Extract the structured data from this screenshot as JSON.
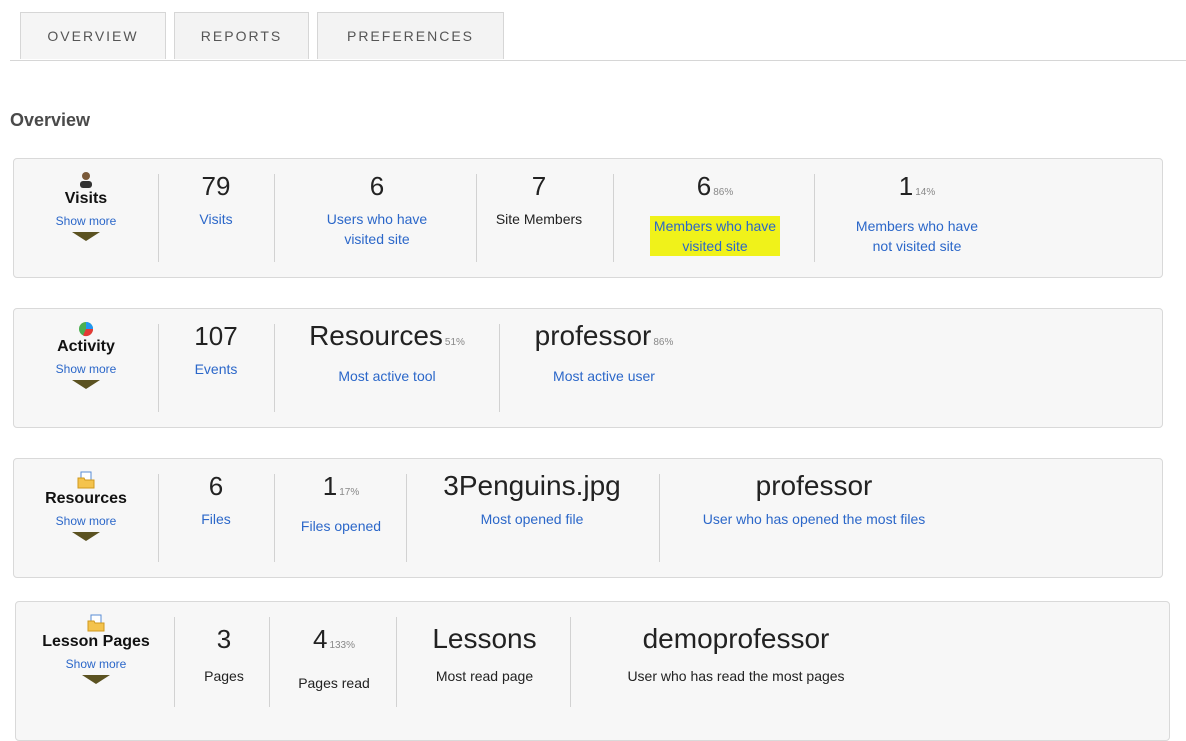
{
  "tabs": [
    "OVERVIEW",
    "REPORTS",
    "PREFERENCES"
  ],
  "page_title": "Overview",
  "visits": {
    "title": "Visits",
    "show_more": "Show more",
    "total_visits": "79",
    "visits_label": "Visits",
    "users_visited": "6",
    "users_visited_label_1": "Users who have",
    "users_visited_label_2": "visited site",
    "site_members": "7",
    "site_members_label": "Site Members",
    "members_visited": "6",
    "members_visited_pct": "86%",
    "members_visited_label_1": "Members who have",
    "members_visited_label_2": "visited site",
    "members_not_visited": "1",
    "members_not_visited_pct": "14%",
    "members_not_visited_label_1": "Members who have",
    "members_not_visited_label_2": "not visited site"
  },
  "activity": {
    "title": "Activity",
    "show_more": "Show more",
    "events": "107",
    "events_label": "Events",
    "tool": "Resources",
    "tool_pct": "51%",
    "tool_label": "Most active tool",
    "user": "professor",
    "user_pct": "86%",
    "user_label": "Most active user"
  },
  "resources": {
    "title": "Resources",
    "show_more": "Show more",
    "files": "6",
    "files_label": "Files",
    "opened": "1",
    "opened_pct": "17%",
    "opened_label": "Files opened",
    "file": "3Penguins.jpg",
    "file_label": "Most opened file",
    "user": "professor",
    "user_label": "User who has opened the most files"
  },
  "lessons": {
    "title": "Lesson Pages",
    "show_more": "Show more",
    "pages": "3",
    "pages_label": "Pages",
    "read": "4",
    "read_pct": "133%",
    "read_label": "Pages read",
    "page": "Lessons",
    "page_label": "Most read page",
    "user": "demoprofessor",
    "user_label": "User who has read the most pages"
  },
  "colors": {
    "link": "#2b67c9",
    "highlight": "#f0f21a",
    "arrow": "#5b5221"
  }
}
